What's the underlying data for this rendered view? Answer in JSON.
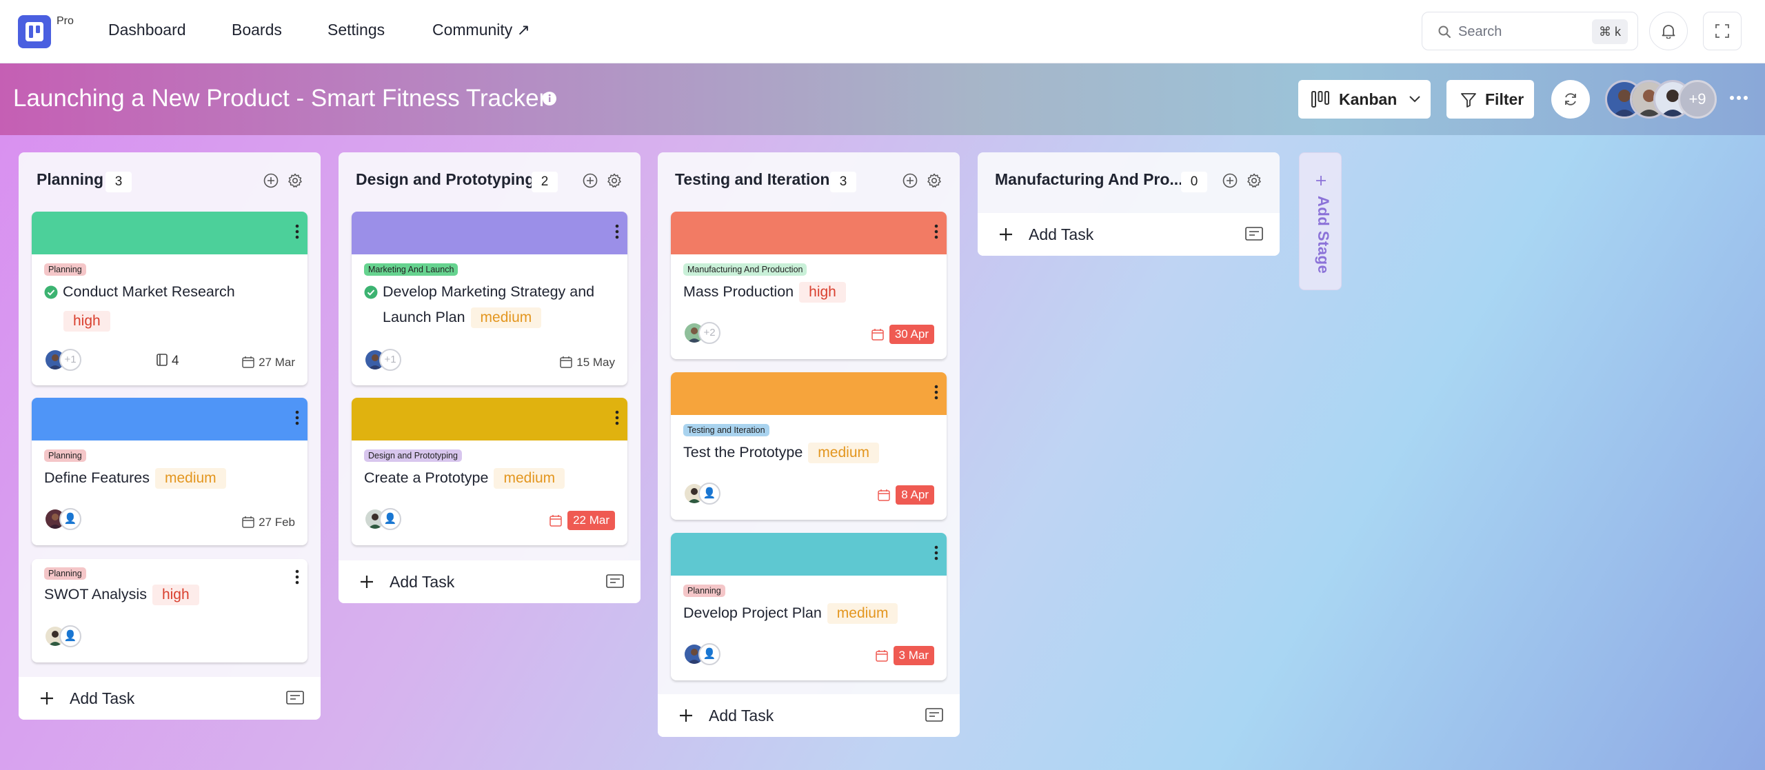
{
  "nav": {
    "pro_label": "Pro",
    "links": [
      "Dashboard",
      "Boards",
      "Settings",
      "Community ↗"
    ],
    "search_placeholder": "Search",
    "search_shortcut": "⌘ k"
  },
  "project": {
    "title": "Launching a New Product - Smart Fitness Tracker",
    "view_label": "Kanban",
    "filter_label": "Filter",
    "members_more": "+9"
  },
  "columns": [
    {
      "title": "Planning",
      "count": "3",
      "add_task": "Add Task",
      "cards": [
        {
          "stage": "Planning",
          "name": "Conduct Market Research",
          "priority": "high",
          "extra": "+1",
          "subtasks": "4",
          "date": "27 Mar",
          "band": "#4cd09a",
          "done": true
        },
        {
          "stage": "Planning",
          "name": "Define Features",
          "priority": "medium",
          "date": "27 Feb",
          "band": "#4f95f7"
        },
        {
          "stage": "Planning",
          "name": "SWOT Analysis",
          "priority": "high"
        }
      ]
    },
    {
      "title": "Design and Prototyping",
      "count": "2",
      "add_task": "Add Task",
      "cards": [
        {
          "stage": "Marketing And Launch",
          "name_line1": "Develop Marketing Strategy and",
          "name_line2": "Launch Plan",
          "priority": "medium",
          "extra": "+1",
          "date": "15 May",
          "band": "#9b8fe8",
          "done": true
        },
        {
          "stage": "Design and Prototyping",
          "name": "Create a Prototype",
          "priority": "medium",
          "date": "22 Mar",
          "band": "#e0b20f"
        }
      ]
    },
    {
      "title": "Testing and Iteration",
      "count": "3",
      "add_task": "Add Task",
      "cards": [
        {
          "stage": "Manufacturing And Production",
          "name": "Mass Production",
          "priority": "high",
          "extra": "+2",
          "date": "30 Apr",
          "band": "#f27b64"
        },
        {
          "stage": "Testing and Iteration",
          "name": "Test the Prototype",
          "priority": "medium",
          "date": "8 Apr",
          "band": "#f6a43c"
        },
        {
          "stage": "Planning",
          "name": "Develop Project Plan",
          "priority": "medium",
          "date": "3 Mar",
          "band": "#5ec8d1"
        }
      ]
    },
    {
      "title": "Manufacturing And Pro...",
      "count": "0",
      "add_task": "Add Task",
      "cards": []
    }
  ],
  "add_stage": "Add Stage",
  "colors": {
    "accent": "#4a5fe0",
    "tag_planning": "#f4c6c8",
    "tag_marketing": "#66d38f",
    "tag_design": "#d8c6ee",
    "tag_testing": "#a9d3ef",
    "tag_manufacturing": "#c9f0d8",
    "due_red": "#ef5a52"
  },
  "icons": [
    "search-icon",
    "bell-icon",
    "fullscreen-icon",
    "info-icon",
    "kanban-icon",
    "chevron-down-icon",
    "filter-icon",
    "refresh-icon",
    "more-icon",
    "plus-circle-icon",
    "gear-icon",
    "kebab-icon",
    "check-circle-icon",
    "calendar-icon",
    "subtask-icon",
    "plus-icon",
    "card-icon"
  ]
}
